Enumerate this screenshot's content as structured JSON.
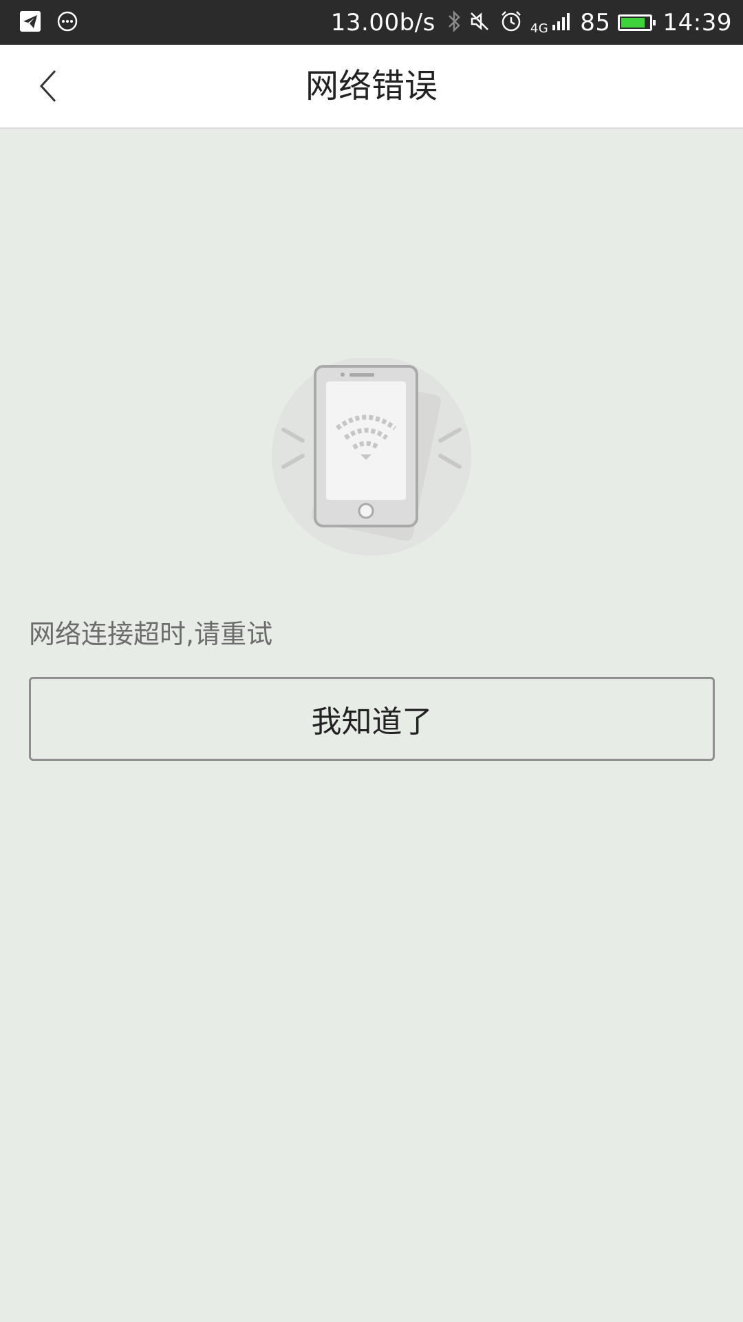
{
  "status_bar": {
    "left_icons": [
      "telegram-icon",
      "chat-bubble-icon"
    ],
    "speed": "13.00b/s",
    "network_type": "4G",
    "battery": "85",
    "battery_level_percent": 85,
    "battery_color": "#3fd23a",
    "time": "14:39"
  },
  "header": {
    "back_icon": "chevron-left-icon",
    "title": "网络错误"
  },
  "main": {
    "illustration_icon": "phone-no-wifi-icon",
    "message": "网络连接超时,请重试",
    "button_label": "我知道了"
  },
  "colors": {
    "status_bar_bg": "#2b2b2b",
    "page_bg": "#e8ece7",
    "header_bg": "#ffffff"
  }
}
